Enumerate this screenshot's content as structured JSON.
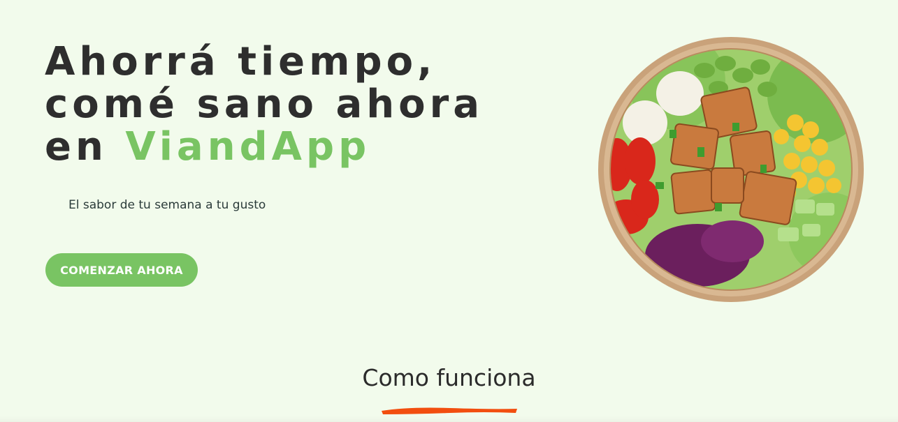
{
  "hero": {
    "title_line1": "Ahorrá tiempo,",
    "title_line2": "comé sano ahora",
    "title_line3_prefix": "en",
    "brand_name": "ViandApp",
    "subtitle": "El sabor de tu semana a tu gusto",
    "cta_label": "COMENZAR AHORA"
  },
  "how_it_works": {
    "title": "Como funciona"
  },
  "colors": {
    "background": "#f2fbec",
    "brand_green": "#79c463",
    "heading_text": "#2e2e2e",
    "accent_orange": "#f24e0f"
  },
  "images": {
    "hero_image": "salad-bowl-icon"
  }
}
